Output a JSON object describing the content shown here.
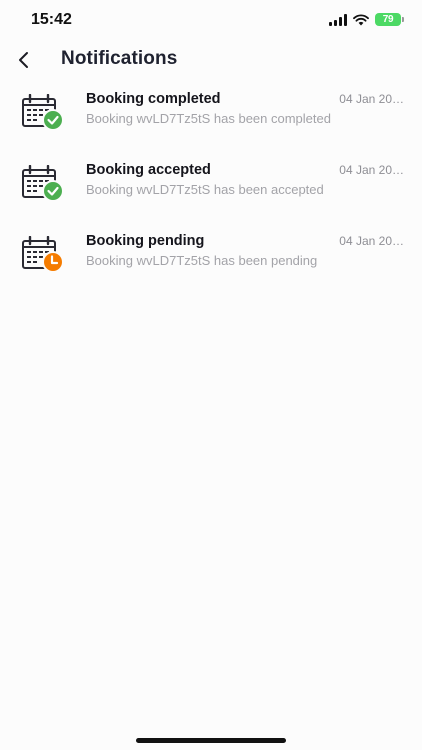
{
  "status_bar": {
    "time": "15:42",
    "battery_level": "79",
    "icons": [
      "signal-icon",
      "wifi-icon",
      "battery-icon"
    ]
  },
  "header": {
    "back_icon": "chevron-left-icon",
    "title": "Notifications"
  },
  "notifications": [
    {
      "title": "Booking completed",
      "message": "Booking wvLD7Tz5tS has been completed",
      "date": "04 Jan 20…",
      "icon": "calendar-check-icon",
      "badge_color": "#4caf50"
    },
    {
      "title": "Booking accepted",
      "message": "Booking wvLD7Tz5tS has been accepted",
      "date": "04 Jan 20…",
      "icon": "calendar-check-icon",
      "badge_color": "#4caf50"
    },
    {
      "title": "Booking pending",
      "message": "Booking wvLD7Tz5tS has been pending",
      "date": "04 Jan 20…",
      "icon": "calendar-clock-icon",
      "badge_color": "#f57c00"
    }
  ],
  "colors": {
    "background": "#fcfcfc",
    "success": "#4caf50",
    "pending": "#f57c00",
    "battery": "#4cd964"
  }
}
